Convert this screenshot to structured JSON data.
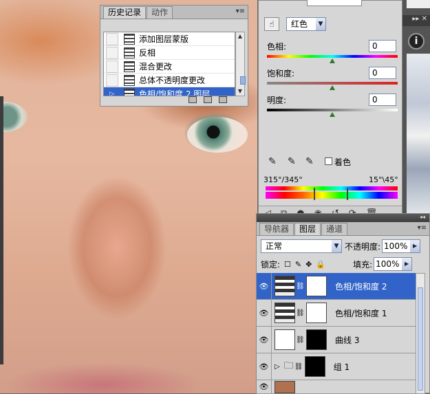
{
  "history_panel": {
    "tabs": [
      "历史记录",
      "动作"
    ],
    "items": [
      "添加图层蒙版",
      "反相",
      "混合更改",
      "总体不透明度更改",
      "色相/饱和度 2 图层"
    ],
    "selected_index": 4
  },
  "hue_sat_panel": {
    "edit_select": "红色",
    "hue_label": "色相:",
    "hue_value": "0",
    "sat_label": "饱和度:",
    "sat_value": "0",
    "light_label": "明度:",
    "light_value": "0",
    "colorize_label": "着色",
    "range_left": "315°/345°",
    "range_right": "15°\\45°"
  },
  "layers_panel": {
    "tabs": [
      "导航器",
      "图层",
      "通道"
    ],
    "blend_mode": "正常",
    "opacity_label": "不透明度:",
    "opacity_value": "100%",
    "lock_label": "锁定:",
    "fill_label": "填充:",
    "fill_value": "100%",
    "layers": [
      {
        "name": "色相/饱和度 2",
        "selected": true
      },
      {
        "name": "色相/饱和度 1",
        "selected": false
      },
      {
        "name": "曲线 3",
        "selected": false
      },
      {
        "name": "组 1",
        "selected": false
      }
    ]
  },
  "colors": {
    "selection": "#3163c8",
    "panel": "#d6d6d6"
  }
}
